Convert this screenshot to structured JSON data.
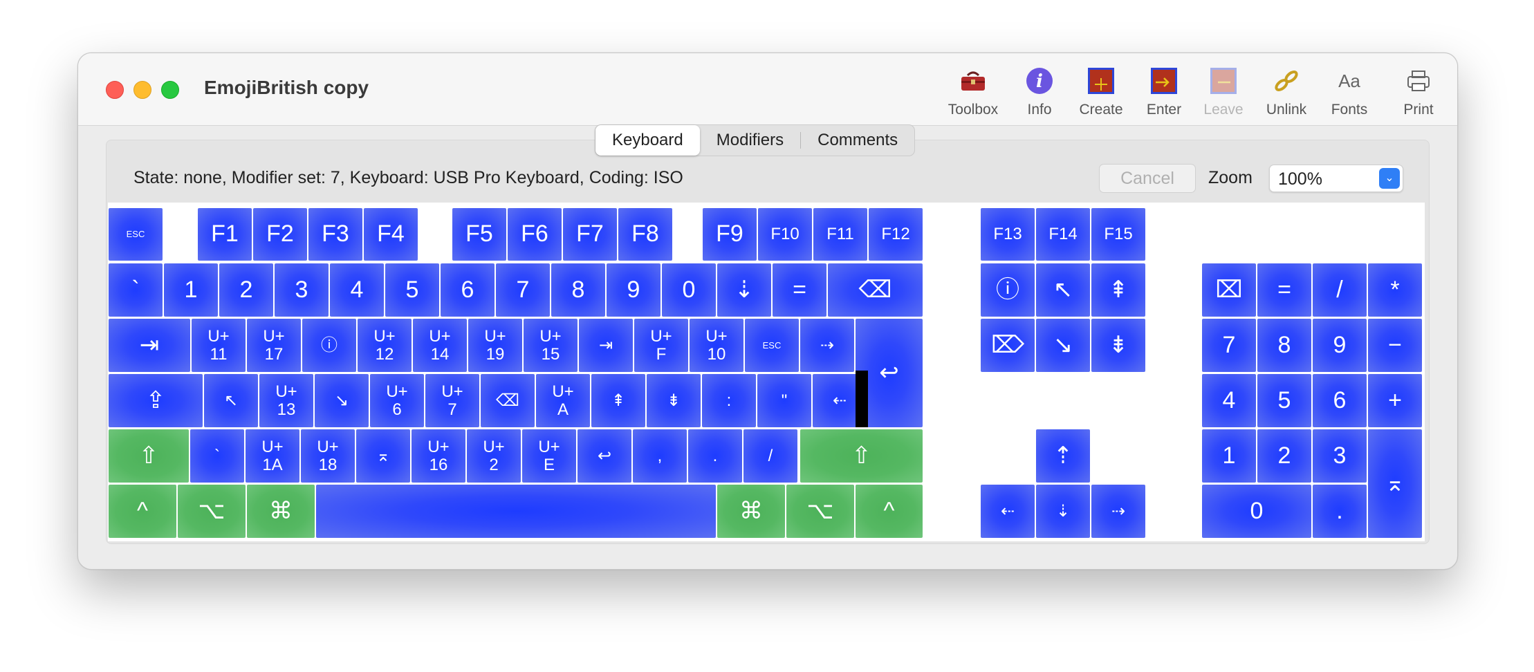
{
  "window": {
    "title": "EmojiBritish copy"
  },
  "toolbar": [
    {
      "id": "toolbox",
      "label": "Toolbox",
      "icon": "toolbox-icon",
      "disabled": false
    },
    {
      "id": "info",
      "label": "Info",
      "icon": "info-icon",
      "disabled": false
    },
    {
      "id": "create",
      "label": "Create",
      "icon": "create-icon",
      "disabled": false
    },
    {
      "id": "enter",
      "label": "Enter",
      "icon": "enter-icon",
      "disabled": false
    },
    {
      "id": "leave",
      "label": "Leave",
      "icon": "leave-icon",
      "disabled": true
    },
    {
      "id": "unlink",
      "label": "Unlink",
      "icon": "unlink-icon",
      "disabled": false
    },
    {
      "id": "fonts",
      "label": "Fonts",
      "icon": "fonts-icon",
      "glyph": "Aa",
      "disabled": false
    },
    {
      "id": "print",
      "label": "Print",
      "icon": "printer-icon",
      "disabled": false
    }
  ],
  "tabs": [
    {
      "label": "Keyboard",
      "active": true
    },
    {
      "label": "Modifiers",
      "active": false
    },
    {
      "label": "Comments",
      "active": false
    }
  ],
  "status": "State: none, Modifier set: 7, Keyboard: USB Pro Keyboard, Coding: ISO",
  "cancel_label": "Cancel",
  "zoom": {
    "label": "Zoom",
    "value": "100%"
  },
  "colors": {
    "key_blue": "#2f48fb",
    "key_green": "#55b862",
    "accent": "#2f7ff6"
  },
  "keys": {
    "row_fn": [
      "ESC",
      "F1",
      "F2",
      "F3",
      "F4",
      "F5",
      "F6",
      "F7",
      "F8",
      "F9",
      "F10",
      "F11",
      "F12",
      "F13",
      "F14",
      "F15"
    ],
    "row_num": [
      "`",
      "1",
      "2",
      "3",
      "4",
      "5",
      "6",
      "7",
      "8",
      "9",
      "0",
      "⇣",
      "=",
      "⌫",
      "ⓘ",
      "↖",
      "⇞",
      "⌧",
      "=",
      "/",
      "*"
    ],
    "row_q": [
      "⇥",
      "U+\n11",
      "U+\n17",
      "ⓘ",
      "U+\n12",
      "U+\n14",
      "U+\n19",
      "U+\n15",
      "⇥",
      "U+\nF",
      "U+\n10",
      "ESC",
      "⇢",
      "↩",
      "⌦",
      "↘",
      "⇟",
      "7",
      "8",
      "9",
      "−"
    ],
    "row_a": [
      "⇪",
      "↖",
      "U+\n13",
      "↘",
      "U+\n6",
      "U+\n7",
      "⌫",
      "U+\nA",
      "⇞",
      "⇟",
      ":",
      "\"",
      "⇠",
      "4",
      "5",
      "6",
      "+"
    ],
    "row_z": [
      "⇧",
      "`",
      "U+\n1A",
      "U+\n18",
      "⌅",
      "U+\n16",
      "U+\n2",
      "U+\nE",
      "↩",
      ",",
      ".",
      "/",
      "⇧",
      "⇡",
      "1",
      "2",
      "3",
      "⌅"
    ],
    "row_bottom": [
      "^",
      "⌥",
      "⌘",
      "",
      "⌘",
      "⌥",
      "^",
      "⇠",
      "⇣",
      "⇢",
      "0",
      "."
    ]
  }
}
